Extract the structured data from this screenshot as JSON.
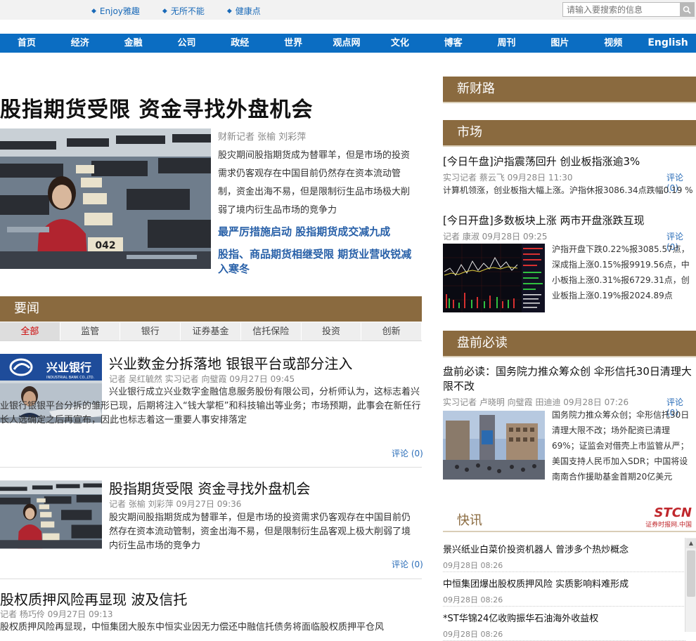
{
  "top_links": [
    "Enjoy雅趣",
    "无所不能",
    "健康点"
  ],
  "search": {
    "placeholder": "请输入要搜索的信息"
  },
  "nav": [
    "首页",
    "经济",
    "金融",
    "公司",
    "政经",
    "世界",
    "观点网",
    "文化",
    "博客",
    "周刊",
    "图片",
    "视频",
    "English"
  ],
  "lead": {
    "title": "股指期货受限 资金寻找外盘机会",
    "meta": "财新记者 张榆 刘彩萍",
    "summary": "股灾期间股指期货成为替罪羊，但是市场的投资需求仍客观存在中国目前仍然存在资本流动管制，资金出海不易，但是限制衍生品市场极大削弱了境内衍生品市场的竞争力",
    "related": [
      "最严厉措施启动 股指期货成交减九成",
      "股指、商品期货相继受限 期货业营收锐减入寒冬"
    ]
  },
  "yaowen": {
    "heading": "要闻",
    "tabs": [
      "全部",
      "监管",
      "银行",
      "证券基金",
      "信托保险",
      "投资",
      "创新"
    ],
    "articles": [
      {
        "title": "兴业数金分拆落地 银银平台或部分注入",
        "meta": "记者 吴红毓然 实习记者 向璧霞 09月27日 09:45",
        "text": "兴业银行成立兴业数字金融信息服务股份有限公司，分析师认为，这标志着兴业银行银银平台分拆的雏形已现，后期将注入“钱大掌柜”和科技输出等业务；市场预期，此事会在新任行长人选确定之后再宣布，因此也标志着这一重要人事安排落定",
        "comment": "评论 (0)",
        "logo": "兴业银行",
        "logo_sub": "INDUSTRIAL BANK CO.,LTD."
      },
      {
        "title": "股指期货受限 资金寻找外盘机会",
        "meta": "记者 张榆 刘彩萍 09月27日 09:36",
        "text": "股灾期间股指期货成为替罪羊，但是市场的投资需求仍客观存在中国目前仍然存在资本流动管制，资金出海不易，但是限制衍生品客观上极大削弱了境内衍生品市场的竞争力",
        "comment": "评论 (0)"
      },
      {
        "title": "股权质押风险再显现 波及信托",
        "meta": "记者 杨巧伶 09月27日 09:13",
        "text": "股权质押风险再显现，中恒集团大股东中恒实业因无力偿还中融信托债务将面临股权质押平仓风"
      }
    ]
  },
  "sidebar": {
    "xincailu": "新财路",
    "shichang": {
      "heading": "市场",
      "items": [
        {
          "title": "[今日午盘]沪指震荡回升 创业板指涨逾3%",
          "meta": "实习记者 蔡云飞 09月28日 11:30",
          "comment": "评论 (0)",
          "text": "计算机领涨，创业板指大幅上涨。沪指休报3086.34点跌幅0.19 %"
        },
        {
          "title": "[今日开盘]多数板块上涨 两市开盘涨跌互现",
          "meta": "记者 康淑 09月28日 09:25",
          "comment": "评论 (0)",
          "text": "沪指开盘下跌0.22%报3085.57点，深成指上涨0.15%报9919.56点，中小板指上涨0.31%报6729.31点，创业板指上涨0.19%报2024.89点"
        }
      ]
    },
    "panqian": {
      "heading": "盘前必读",
      "title": "盘前必读：国务院力推众筹众创 伞形信托30日清理大限不改",
      "meta": "实习记者 卢晓明 向璧霞 田迪迪 09月28日 07:26",
      "comment": "评论 (0)",
      "text": "国务院力推众筹众创；伞形信托30日清理大限不改；场外配资已清理69%；证监会对借壳上市监管从严；美国支持人民币加入SDR；中国将设南南合作援助基金首期20亿美元"
    },
    "kuaixun": {
      "heading": "快讯",
      "brand": "STCN",
      "brand_sub": "证券时报网.中国",
      "items": [
        {
          "title": "景兴纸业白菜价投资机器人 曾涉多个热炒概念",
          "date": "09月28日  08:26"
        },
        {
          "title": "中恒集团爆出股权质押风险 实质影响料难形成",
          "date": "09月28日  08:26"
        },
        {
          "title": "*ST华锦24亿收购振华石油海外收益权",
          "date": "09月28日  08:26"
        }
      ]
    }
  }
}
